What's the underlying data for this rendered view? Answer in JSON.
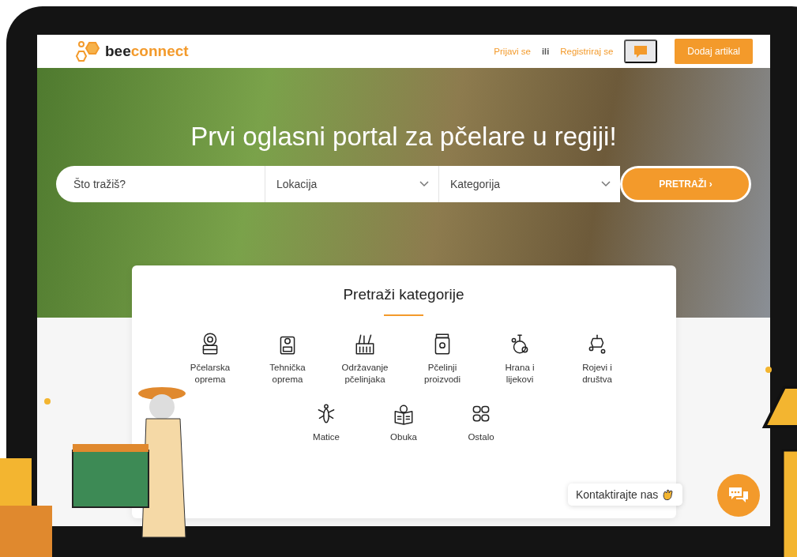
{
  "header": {
    "logo": {
      "prefix": "bee",
      "suffix": "connect"
    },
    "login_link": "Prijavi se",
    "separator": "ili",
    "register_link": "Registriraj se",
    "add_button": "Dodaj artikal"
  },
  "hero": {
    "title": "Prvi oglasni portal za pčelare u regiji!"
  },
  "search": {
    "placeholder": "Što tražiš?",
    "location": "Lokacija",
    "category": "Kategorija",
    "button": "PRETRAŽI ›"
  },
  "categories": {
    "title": "Pretraži kategorije",
    "items": [
      {
        "label": "Pčelarska oprema"
      },
      {
        "label": "Tehnička oprema"
      },
      {
        "label": "Održavanje pčelinjaka"
      },
      {
        "label": "Pčelinji proizvodi"
      },
      {
        "label": "Hrana i lijekovi"
      },
      {
        "label": "Rojevi i društva"
      },
      {
        "label": "Matice"
      },
      {
        "label": "Obuka"
      },
      {
        "label": "Ostalo"
      }
    ]
  },
  "chat": {
    "tooltip": "Kontaktirajte nas"
  }
}
